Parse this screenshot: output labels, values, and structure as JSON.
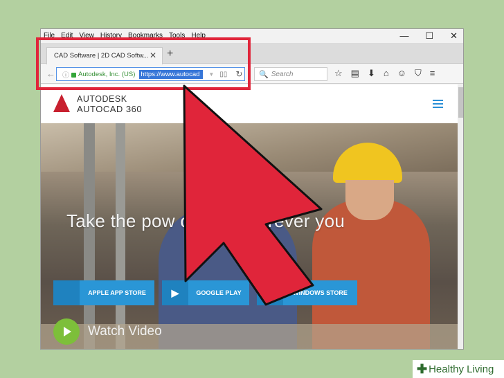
{
  "browser": {
    "menu": [
      "File",
      "Edit",
      "View",
      "History",
      "Bookmarks",
      "Tools",
      "Help"
    ],
    "window_controls": [
      "—",
      "☐",
      "✕"
    ],
    "tab": {
      "title": "CAD Software | 2D CAD Softw...",
      "close": "✕"
    },
    "new_tab": "+",
    "back": "←",
    "info": "ⓘ",
    "site_identity": "Autodesk, Inc. (US)",
    "url": "https://www.autocad",
    "dropdown": "▼",
    "reader": "▯▯",
    "reload": "↻",
    "search_placeholder": "Search",
    "search_glyph": "🔍",
    "toolbar_icons": [
      "☆",
      "▤",
      "⬇",
      "⌂",
      "☺",
      "⛉",
      "≡"
    ]
  },
  "site": {
    "brand_line1": "AUTODESK",
    "brand_line2": "AUTOCAD 360",
    "headline": "Take the pow         oCAD wherever you",
    "stores": [
      {
        "label": "APPLE APP STORE",
        "icon": "apple-icon",
        "glyph": ""
      },
      {
        "label": "GOOGLE PLAY",
        "icon": "bag-icon",
        "glyph": "▶"
      },
      {
        "label": "WINDOWS STORE",
        "icon": "windows-icon",
        "glyph": "⊞"
      }
    ],
    "watch_label": "Watch Video"
  },
  "watermark": {
    "cross": "✚",
    "text": "Healthy Living"
  },
  "colors": {
    "highlight": "#e0253a",
    "arrow": "#e0253a",
    "accent": "#2a96d6",
    "brand_red": "#c8202f",
    "play": "#7dbf3a"
  }
}
